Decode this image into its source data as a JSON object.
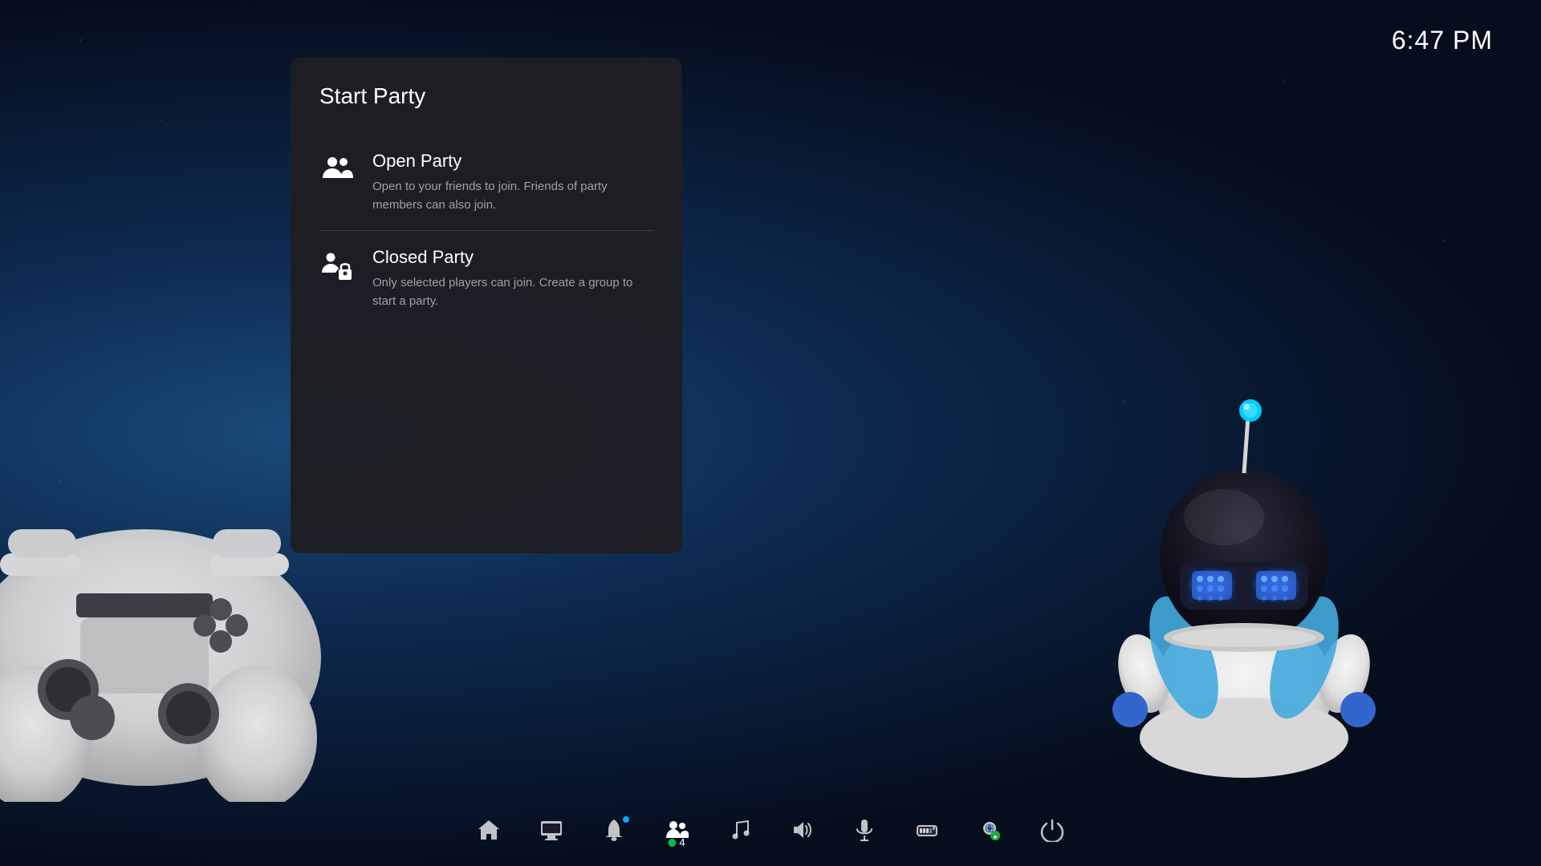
{
  "clock": {
    "time": "6:47 PM"
  },
  "modal": {
    "title": "Start Party",
    "options": [
      {
        "id": "open-party",
        "name": "Open Party",
        "description": "Open to your friends to join. Friends of party members can also join.",
        "icon": "open-party-icon"
      },
      {
        "id": "closed-party",
        "name": "Closed Party",
        "description": "Only selected players can join. Create a group to start a party.",
        "icon": "closed-party-icon"
      }
    ]
  },
  "taskbar": {
    "items": [
      {
        "id": "home",
        "icon": "home-icon",
        "label": ""
      },
      {
        "id": "media",
        "icon": "media-icon",
        "label": ""
      },
      {
        "id": "notifications",
        "icon": "bell-icon",
        "label": "",
        "has_dot": true
      },
      {
        "id": "friends",
        "icon": "friends-icon",
        "label": "4",
        "active": true,
        "has_badge": true
      },
      {
        "id": "music",
        "icon": "music-icon",
        "label": ""
      },
      {
        "id": "volume",
        "icon": "volume-icon",
        "label": ""
      },
      {
        "id": "mic",
        "icon": "mic-icon",
        "label": ""
      },
      {
        "id": "gamepad",
        "icon": "gamepad-icon",
        "label": ""
      },
      {
        "id": "network",
        "icon": "network-icon",
        "label": ""
      },
      {
        "id": "power",
        "icon": "power-icon",
        "label": ""
      }
    ]
  }
}
